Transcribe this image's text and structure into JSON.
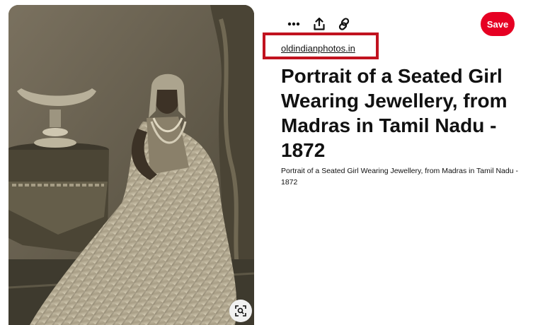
{
  "pin": {
    "source_link": "oldindianphotos.in",
    "title": "Portrait of a Seated Girl Wearing Jewellery, from Madras in Tamil Nadu - 1872",
    "description": "Portrait of a Seated Girl Wearing Jewellery, from Madras in Tamil Nadu - 1872"
  },
  "toolbar": {
    "save_label": "Save",
    "icons": [
      "more-options-icon",
      "share-icon",
      "link-icon"
    ]
  },
  "image": {
    "lens_icon": "visual-search-icon"
  },
  "colors": {
    "save": "#e60023",
    "highlight_box": "#c1121f"
  }
}
